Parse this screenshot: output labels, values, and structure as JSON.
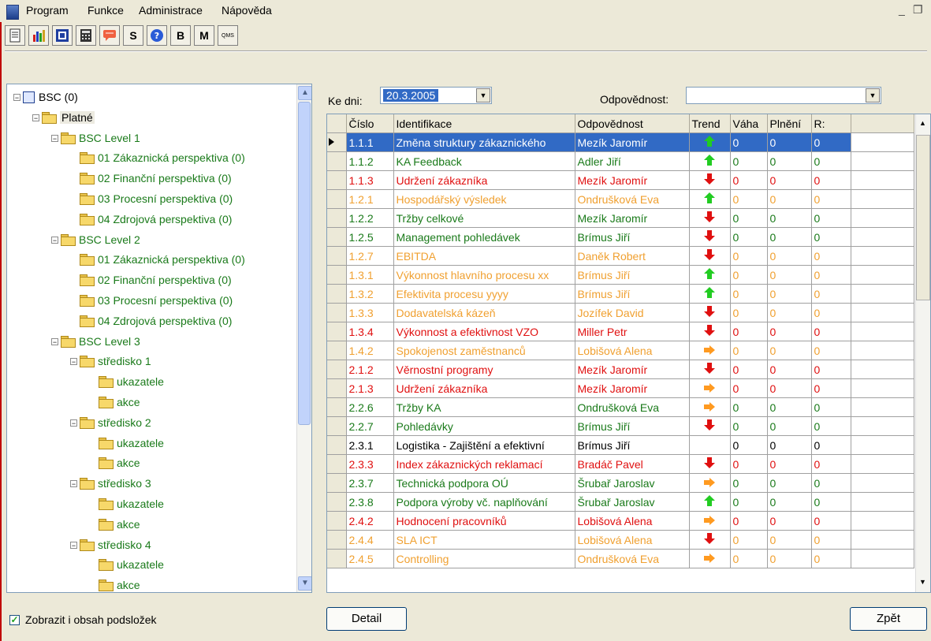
{
  "menu": [
    "Program",
    "Funkce",
    "Administrace",
    "Nápověda"
  ],
  "toolbar": {
    "buttons": [
      {
        "name": "print-icon",
        "label": ""
      },
      {
        "name": "chart-icon",
        "label": ""
      },
      {
        "name": "grid-view-icon",
        "label": ""
      },
      {
        "name": "calculator-icon",
        "label": ""
      },
      {
        "name": "comment-icon",
        "label": ""
      },
      {
        "name": "s-button",
        "label": "S"
      },
      {
        "name": "help-icon",
        "label": ""
      },
      {
        "name": "b-button",
        "label": "B"
      },
      {
        "name": "m-button",
        "label": "M"
      },
      {
        "name": "qms-button",
        "label": "QMS"
      }
    ]
  },
  "tree": {
    "nodes": [
      {
        "label": "BSC (0)",
        "color": "black"
      },
      {
        "label": "Platné",
        "color": "black"
      },
      {
        "label": "BSC Level 1",
        "color": "green"
      },
      {
        "label": "01 Zákaznická perspektiva (0)",
        "color": "green"
      },
      {
        "label": "02 Finanční perspektiva (0)",
        "color": "green"
      },
      {
        "label": "03 Procesní perspektiva (0)",
        "color": "green"
      },
      {
        "label": "04 Zdrojová perspektiva (0)",
        "color": "green"
      },
      {
        "label": "BSC Level 2",
        "color": "green"
      },
      {
        "label": "01 Zákaznická perspektiva (0)",
        "color": "green"
      },
      {
        "label": "02 Finanční perspektiva (0)",
        "color": "green"
      },
      {
        "label": "03 Procesní perspektiva (0)",
        "color": "green"
      },
      {
        "label": "04 Zdrojová perspektiva (0)",
        "color": "green"
      },
      {
        "label": "BSC Level 3",
        "color": "green"
      },
      {
        "label": "středisko 1",
        "color": "green"
      },
      {
        "label": "ukazatele",
        "color": "green"
      },
      {
        "label": "akce",
        "color": "green"
      },
      {
        "label": "středisko 2",
        "color": "green"
      },
      {
        "label": "ukazatele",
        "color": "green"
      },
      {
        "label": "akce",
        "color": "green"
      },
      {
        "label": "středisko 3",
        "color": "green"
      },
      {
        "label": "ukazatele",
        "color": "green"
      },
      {
        "label": "akce",
        "color": "green"
      },
      {
        "label": "středisko 4",
        "color": "green"
      },
      {
        "label": "ukazatele",
        "color": "green"
      },
      {
        "label": "akce",
        "color": "green"
      }
    ]
  },
  "show_subfolders": {
    "label": "Zobrazit i obsah podsložek",
    "checked": true
  },
  "filter": {
    "date_label": "Ke dni:",
    "date_value": "20.3.2005",
    "owner_label": "Odpovědnost:",
    "owner_value": ""
  },
  "grid": {
    "columns": [
      "Číslo",
      "Identifikace",
      "Odpovědnost",
      "Trend",
      "Váha",
      "Plnění",
      "R:"
    ],
    "rows": [
      {
        "c": "1.1.1",
        "id": "Změna struktury zákaznického",
        "o": "Mezík Jaromír",
        "t": "up",
        "v": "0",
        "p": "0",
        "r": "0",
        "color": "green",
        "selected": true
      },
      {
        "c": "1.1.2",
        "id": "KA Feedback",
        "o": "Adler Jiří",
        "t": "up",
        "v": "0",
        "p": "0",
        "r": "0",
        "color": "green"
      },
      {
        "c": "1.1.3",
        "id": "Udržení zákazníka",
        "o": "Mezík Jaromír",
        "t": "down",
        "v": "0",
        "p": "0",
        "r": "0",
        "color": "red"
      },
      {
        "c": "1.2.1",
        "id": "Hospodářský výsledek",
        "o": "Ondrušková Eva",
        "t": "up",
        "v": "0",
        "p": "0",
        "r": "0",
        "color": "orange"
      },
      {
        "c": "1.2.2",
        "id": "Tržby celkové",
        "o": "Mezík Jaromír",
        "t": "down",
        "v": "0",
        "p": "0",
        "r": "0",
        "color": "green"
      },
      {
        "c": "1.2.5",
        "id": "Management pohledávek",
        "o": "Brímus Jiří",
        "t": "down",
        "v": "0",
        "p": "0",
        "r": "0",
        "color": "green"
      },
      {
        "c": "1.2.7",
        "id": "EBITDA",
        "o": "Daněk Robert",
        "t": "down",
        "v": "0",
        "p": "0",
        "r": "0",
        "color": "orange"
      },
      {
        "c": "1.3.1",
        "id": "Výkonnost hlavního procesu xx",
        "o": "Brímus Jiří",
        "t": "up",
        "v": "0",
        "p": "0",
        "r": "0",
        "color": "orange"
      },
      {
        "c": "1.3.2",
        "id": "Efektivita procesu yyyy",
        "o": "Brímus Jiří",
        "t": "up",
        "v": "0",
        "p": "0",
        "r": "0",
        "color": "orange"
      },
      {
        "c": "1.3.3",
        "id": "Dodavatelská kázeň",
        "o": "Jozífek David",
        "t": "down",
        "v": "0",
        "p": "0",
        "r": "0",
        "color": "orange"
      },
      {
        "c": "1.3.4",
        "id": "Výkonnost a efektivnost VZO",
        "o": "Miller Petr",
        "t": "down",
        "v": "0",
        "p": "0",
        "r": "0",
        "color": "red"
      },
      {
        "c": "1.4.2",
        "id": "Spokojenost zaměstnanců",
        "o": "Lobišová Alena",
        "t": "right",
        "v": "0",
        "p": "0",
        "r": "0",
        "color": "orange"
      },
      {
        "c": "2.1.2",
        "id": "Věrnostní programy",
        "o": "Mezík Jaromír",
        "t": "down",
        "v": "0",
        "p": "0",
        "r": "0",
        "color": "red"
      },
      {
        "c": "2.1.3",
        "id": "Udržení zákazníka",
        "o": "Mezík Jaromír",
        "t": "right",
        "v": "0",
        "p": "0",
        "r": "0",
        "color": "red"
      },
      {
        "c": "2.2.6",
        "id": "Tržby KA",
        "o": "Ondrušková Eva",
        "t": "right",
        "v": "0",
        "p": "0",
        "r": "0",
        "color": "green"
      },
      {
        "c": "2.2.7",
        "id": "Pohledávky",
        "o": "Brímus Jiří",
        "t": "down",
        "v": "0",
        "p": "0",
        "r": "0",
        "color": "green"
      },
      {
        "c": "2.3.1",
        "id": "Logistika - Zajištění a efektivní",
        "o": "Brímus Jiří",
        "t": "",
        "v": "0",
        "p": "0",
        "r": "0",
        "color": "black"
      },
      {
        "c": "2.3.3",
        "id": "Index zákaznických reklamací",
        "o": "Bradáč Pavel",
        "t": "down",
        "v": "0",
        "p": "0",
        "r": "0",
        "color": "red"
      },
      {
        "c": "2.3.7",
        "id": "Technická podpora  OÚ",
        "o": "Šrubař Jaroslav",
        "t": "right",
        "v": "0",
        "p": "0",
        "r": "0",
        "color": "green"
      },
      {
        "c": "2.3.8",
        "id": "Podpora výroby vč. naplňování",
        "o": "Šrubař Jaroslav",
        "t": "up",
        "v": "0",
        "p": "0",
        "r": "0",
        "color": "green"
      },
      {
        "c": "2.4.2",
        "id": "Hodnocení pracovníků",
        "o": "Lobišová Alena",
        "t": "right",
        "v": "0",
        "p": "0",
        "r": "0",
        "color": "red"
      },
      {
        "c": "2.4.4",
        "id": "SLA ICT",
        "o": "Lobišová Alena",
        "t": "down",
        "v": "0",
        "p": "0",
        "r": "0",
        "color": "orange"
      },
      {
        "c": "2.4.5",
        "id": "Controlling",
        "o": "Ondrušková Eva",
        "t": "right",
        "v": "0",
        "p": "0",
        "r": "0",
        "color": "orange"
      }
    ]
  },
  "buttons": {
    "detail": "Detail",
    "back": "Zpět"
  },
  "colors": {
    "green": "#1a7a1a",
    "red": "#e01010",
    "orange": "#f0a030",
    "selection": "#316ac5"
  }
}
